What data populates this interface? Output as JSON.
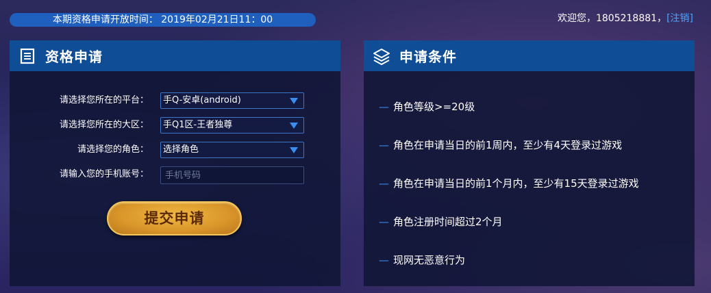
{
  "top": {
    "open_time": "本期资格申请开放时间： 2019年02月21日11：00",
    "welcome": "欢迎您，1805218881，",
    "logout": "[注销]"
  },
  "apply_panel": {
    "title": "资格申请",
    "icon": "document-icon",
    "platform_label": "请选择您所在的平台：",
    "platform_value": "手Q-安卓(android)",
    "region_label": "请选择您所在的大区：",
    "region_value": "手Q1区-王者独尊",
    "role_label": "请选择您的角色：",
    "role_value": "选择角色",
    "phone_label": "请输入您的手机账号：",
    "phone_placeholder": "手机号码",
    "submit_label": "提交申请"
  },
  "conditions_panel": {
    "title": "申请条件",
    "icon": "layers-icon",
    "dash": "—",
    "items": [
      "角色等级>=20级",
      "角色在申请当日的前1周内，至少有4天登录过游戏",
      "角色在申请当日的前1个月内，至少有15天登录过游戏",
      "角色注册时间超过2个月",
      "现网无恶意行为"
    ]
  },
  "colors": {
    "header_blue": "#0f4e96",
    "accent_blue": "#3a8ef0",
    "button_gold": "#d9952a"
  }
}
